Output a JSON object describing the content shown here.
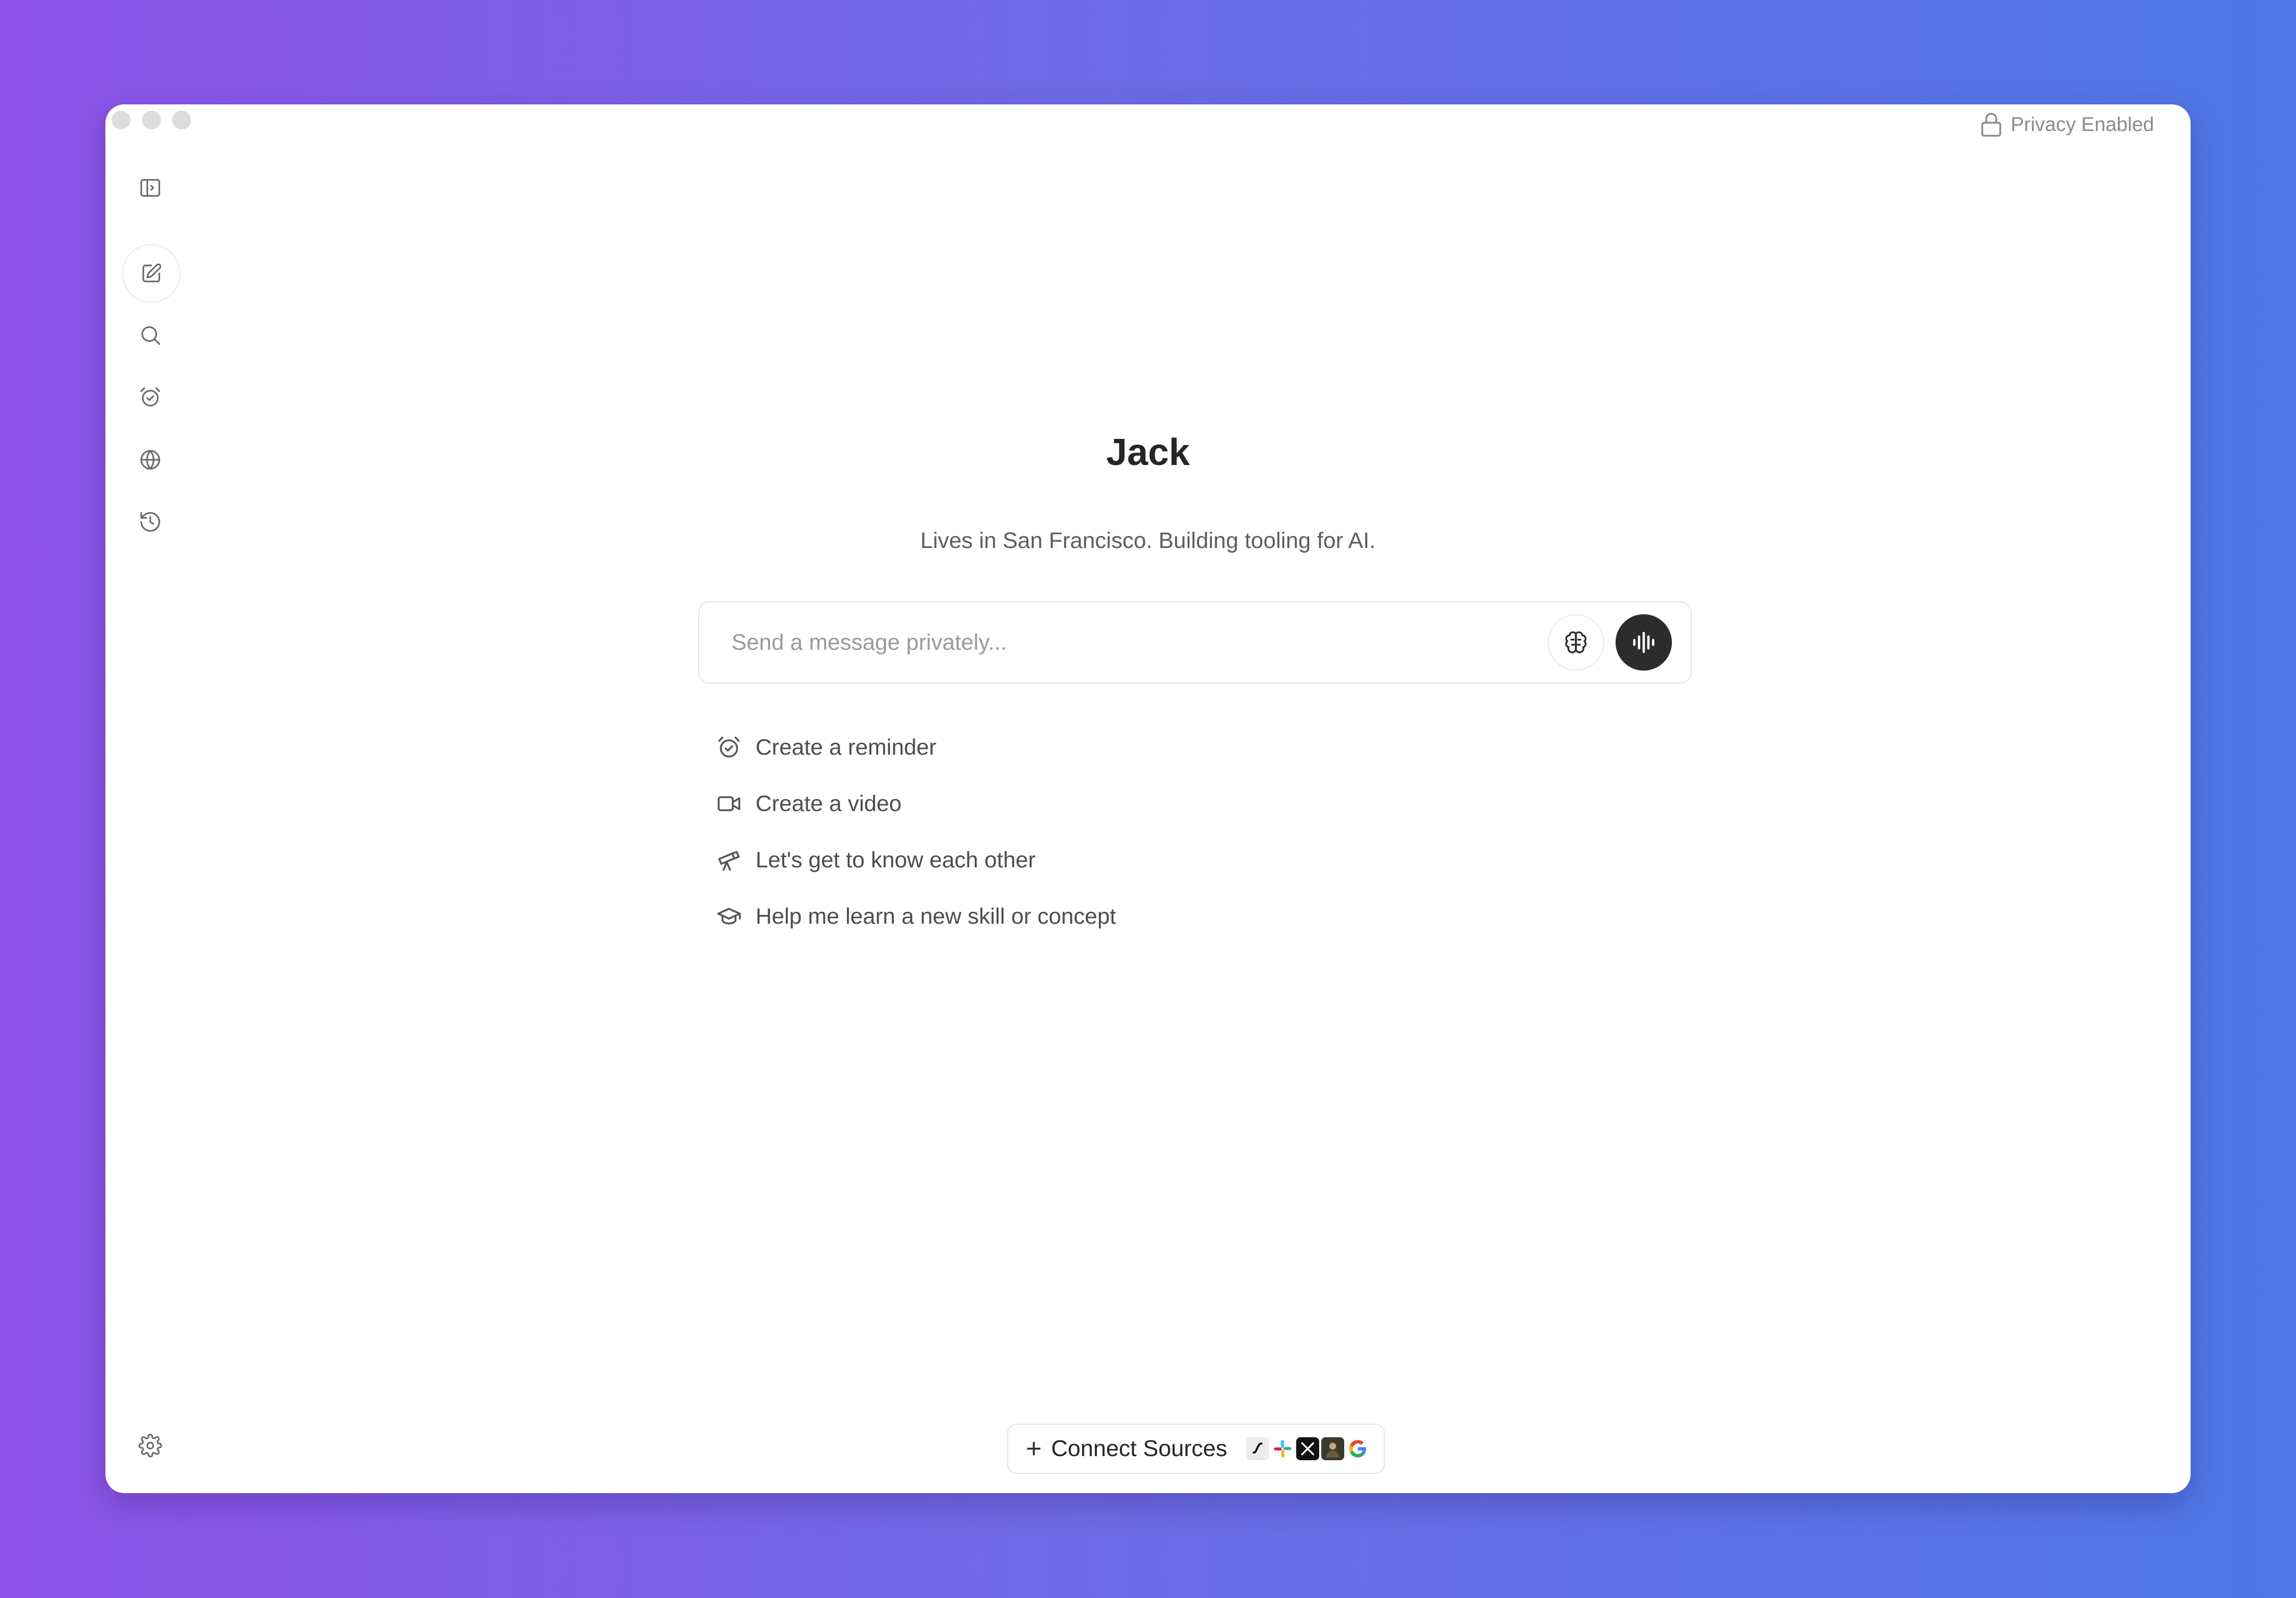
{
  "window": {
    "traffic_lights": [
      "close",
      "minimize",
      "zoom"
    ],
    "privacy_label": "Privacy Enabled",
    "privacy_icon": "lock-icon"
  },
  "sidebar": {
    "icons": [
      "sidebar-toggle-icon",
      "new-chat-icon",
      "search-icon",
      "alarm-icon",
      "globe-icon",
      "history-icon"
    ],
    "settings_icon": "gear-icon"
  },
  "main": {
    "title": "Jack",
    "subtitle": "Lives in San Francisco. Building tooling for AI.",
    "composer": {
      "placeholder": "Send a message privately...",
      "memory_button_icon": "brain-icon",
      "voice_button_icon": "waveform-icon"
    },
    "suggestions": [
      {
        "icon": "alarm-icon",
        "label": "Create a reminder"
      },
      {
        "icon": "video-icon",
        "label": "Create a video"
      },
      {
        "icon": "telescope-icon",
        "label": "Let's get to know each other"
      },
      {
        "icon": "graduation-cap-icon",
        "label": "Help me learn a new skill or concept"
      }
    ]
  },
  "footer": {
    "connect_label": "Connect Sources",
    "source_logos": [
      "notion-logo",
      "slack-logo",
      "x-logo",
      "photo-logo",
      "google-logo"
    ]
  },
  "colors": {
    "background_start": "#8e52e9",
    "background_end": "#4f77e6",
    "voice_button": "#2c2c2c"
  }
}
